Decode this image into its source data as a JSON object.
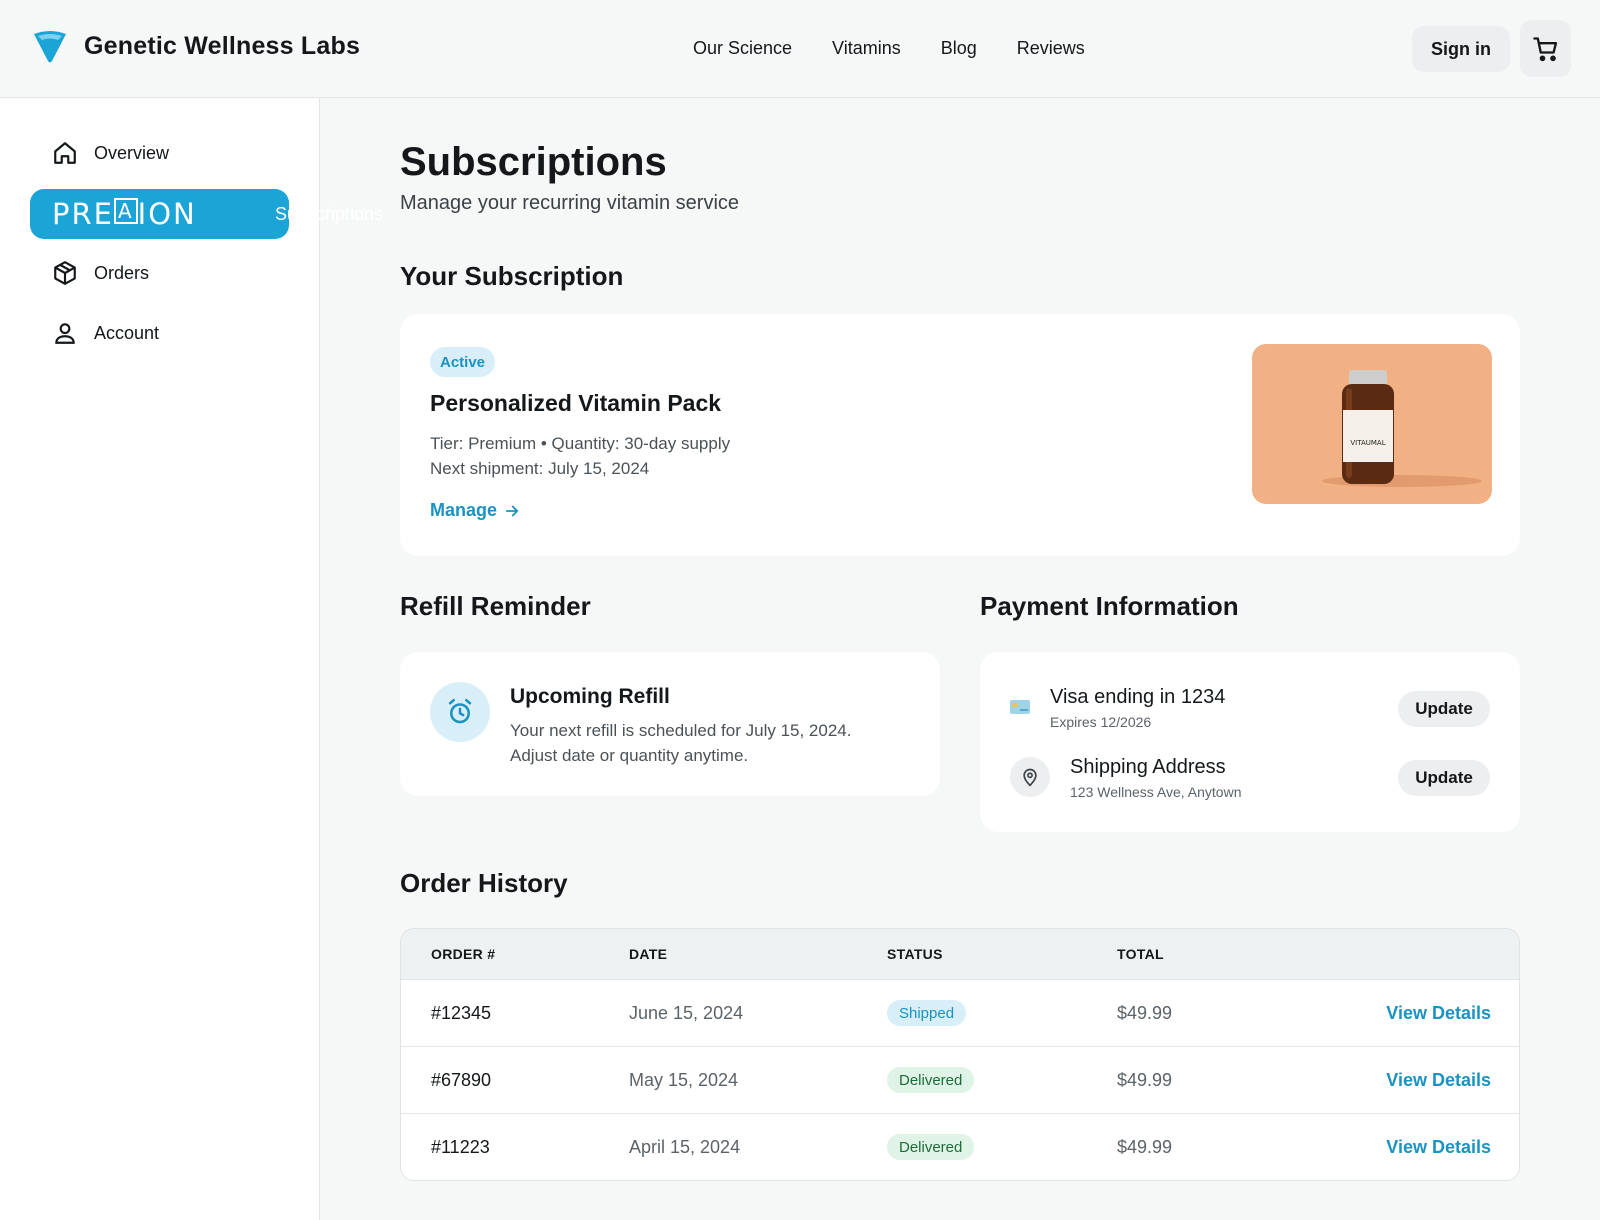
{
  "brand": {
    "name": "Genetic Wellness Labs"
  },
  "nav": [
    "Our Science",
    "Vitamins",
    "Blog",
    "Reviews"
  ],
  "header": {
    "signin_label": "Sign in"
  },
  "sidebar": {
    "items": [
      {
        "label": "Overview",
        "icon": "home-icon"
      },
      {
        "label": "Subscriptions",
        "icon": "brand-stamp",
        "stamp": "PRE",
        "stamp_boxed": "A",
        "stamp_tail": "ION"
      },
      {
        "label": "Orders",
        "icon": "box-icon"
      },
      {
        "label": "Account",
        "icon": "user-icon"
      }
    ]
  },
  "page": {
    "title": "Subscriptions",
    "subtitle": "Manage your recurring vitamin service"
  },
  "subscription": {
    "section_title": "Your Subscription",
    "status": "Active",
    "name": "Personalized Vitamin Pack",
    "tier": "Tier: Premium",
    "quantity": "Quantity: 30-day supply",
    "next_shipment": "Next shipment: July 15, 2024",
    "manage_label": "Manage",
    "product_label": "VITAUMAL"
  },
  "refill": {
    "section_title": "Refill Reminder",
    "title": "Upcoming Refill",
    "text": "Your next refill is scheduled for July 15, 2024. Adjust date or quantity anytime."
  },
  "payment": {
    "section_title": "Payment Information",
    "card_title": "Visa ending in 1234",
    "card_sub": "Expires 12/2026",
    "address_title": "Shipping Address",
    "address_sub": "123 Wellness Ave, Anytown",
    "update_label": "Update"
  },
  "orders": {
    "section_title": "Order History",
    "columns": [
      "ORDER #",
      "DATE",
      "STATUS",
      "TOTAL"
    ],
    "rows": [
      {
        "order": "#12345",
        "date": "June 15, 2024",
        "status": "Shipped",
        "total": "$49.99",
        "action": "View Details"
      },
      {
        "order": "#67890",
        "date": "May 15, 2024",
        "status": "Delivered",
        "total": "$49.99",
        "action": "View Details"
      },
      {
        "order": "#11223",
        "date": "April 15, 2024",
        "status": "Delivered",
        "total": "$49.99",
        "action": "View Details"
      }
    ]
  },
  "colors": {
    "accent": "#1ba4d6",
    "link": "#1a93c2",
    "shipped_bg": "#d8eef8",
    "delivered_bg": "#dff4e6",
    "delivered_text": "#1f6b3a"
  }
}
